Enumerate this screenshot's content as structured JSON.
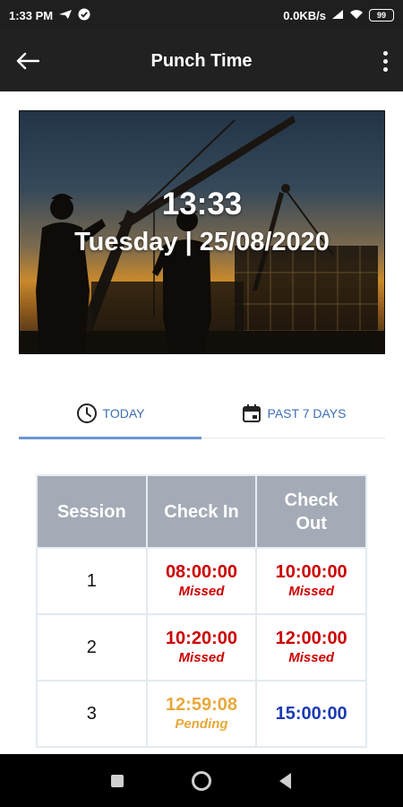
{
  "status_bar": {
    "time": "1:33 PM",
    "network_speed": "0.0KB/s",
    "battery": "99"
  },
  "app_bar": {
    "title": "Punch Time"
  },
  "banner": {
    "time": "13:33",
    "date": "Tuesday | 25/08/2020"
  },
  "tabs": [
    {
      "label": "TODAY",
      "icon": "clock-icon",
      "selected": true
    },
    {
      "label": "PAST 7 DAYS",
      "icon": "calendar-icon",
      "selected": false
    }
  ],
  "table": {
    "headers": {
      "session": "Session",
      "check_in_1": "Check In",
      "check_out_1": "Check",
      "check_out_2": "Out"
    },
    "rows": [
      {
        "session": "1",
        "check_in": {
          "time": "08:00:00",
          "status": "Missed"
        },
        "check_out": {
          "time": "10:00:00",
          "status": "Missed"
        }
      },
      {
        "session": "2",
        "check_in": {
          "time": "10:20:00",
          "status": "Missed"
        },
        "check_out": {
          "time": "12:00:00",
          "status": "Missed"
        }
      },
      {
        "session": "3",
        "check_in": {
          "time": "12:59:08",
          "status": "Pending"
        },
        "check_out": {
          "time": "15:00:00",
          "status": ""
        }
      }
    ]
  },
  "colors": {
    "missed": "#cc0000",
    "pending": "#e8a83a",
    "scheduled": "#1b3bb3",
    "accent": "#3d6fb4",
    "header_bg": "#a4abb6"
  }
}
